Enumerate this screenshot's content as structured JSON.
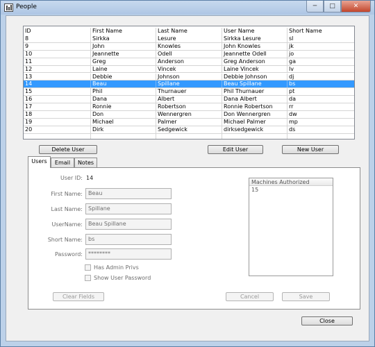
{
  "window": {
    "title": "People",
    "minimize": "─",
    "maximize": "□",
    "close": "✕"
  },
  "grid": {
    "columns": [
      "ID",
      "First Name",
      "Last Name",
      "User Name",
      "Short Name"
    ],
    "rows": [
      [
        "8",
        "Sirkka",
        "Lesure",
        "Sirkka Lesure",
        "sl"
      ],
      [
        "9",
        "John",
        "Knowles",
        "John Knowles",
        "jk"
      ],
      [
        "10",
        "Jeannette",
        "Odell",
        "Jeannette Odell",
        "jo"
      ],
      [
        "11",
        "Greg",
        "Anderson",
        "Greg Anderson",
        "ga"
      ],
      [
        "12",
        "Laine",
        "Vincek",
        "Laine Vincek",
        "lv"
      ],
      [
        "13",
        "Debbie",
        "Johnson",
        "Debbie Johnson",
        "dj"
      ],
      [
        "14",
        "Beau",
        "Spillane",
        "Beau Spillane",
        "bs"
      ],
      [
        "15",
        "Phil",
        "Thurnauer",
        "Phil Thurnauer",
        "pt"
      ],
      [
        "16",
        "Dana",
        "Albert",
        "Dana Albert",
        "da"
      ],
      [
        "17",
        "Ronnie",
        "Robertson",
        "Ronnie Robertson",
        "rr"
      ],
      [
        "18",
        "Don",
        "Wennergren",
        "Don Wennergren",
        "dw"
      ],
      [
        "19",
        "Michael",
        "Palmer",
        "Michael Palmer",
        "mp"
      ],
      [
        "20",
        "Dirk",
        "Sedgewick",
        "dirksedgewick",
        "ds"
      ]
    ],
    "selected_index": 6
  },
  "buttons": {
    "delete_user": "Delete User",
    "edit_user": "Edit User",
    "new_user": "New User",
    "clear_fields": "Clear Fields",
    "cancel": "Cancel",
    "save": "Save",
    "close": "Close"
  },
  "tabs": [
    {
      "label": "Users"
    },
    {
      "label": "Email"
    },
    {
      "label": "Notes"
    }
  ],
  "form": {
    "user_id_label": "User ID:",
    "user_id_value": "14",
    "first_name_label": "First Name:",
    "first_name_value": "Beau",
    "last_name_label": "Last Name:",
    "last_name_value": "Spillane",
    "username_label": "UserName:",
    "username_value": "Beau Spillane",
    "short_name_label": "Short Name:",
    "short_name_value": "bs",
    "password_label": "Password:",
    "password_value": "********",
    "admin_privs_label": "Has Admin Privs",
    "show_password_label": "Show User Password"
  },
  "machines": {
    "header": "Machines Authorized",
    "items": [
      "15"
    ]
  }
}
